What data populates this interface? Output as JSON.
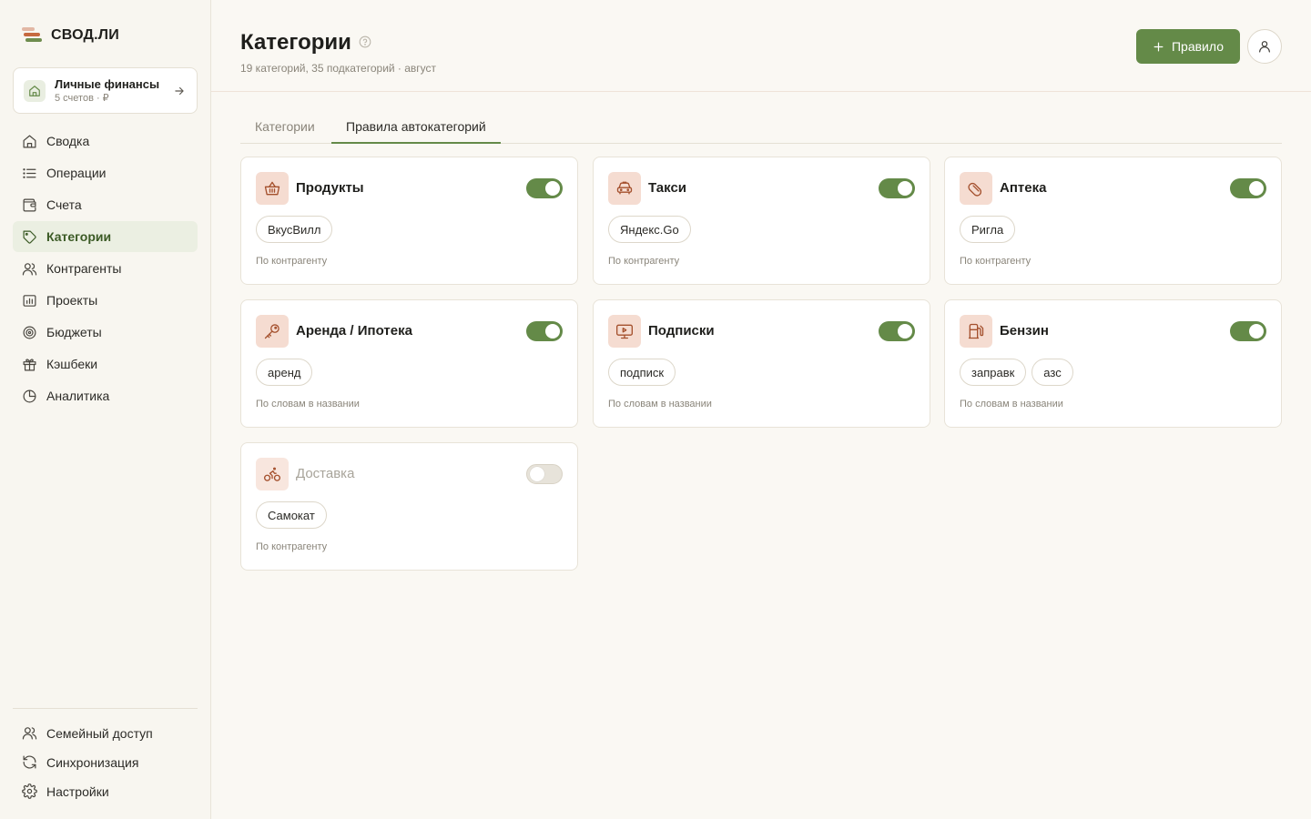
{
  "brand": {
    "name": "СВОД.ЛИ"
  },
  "account": {
    "title": "Личные финансы",
    "subtitle": "5 счетов · ₽"
  },
  "nav": [
    {
      "label": "Сводка",
      "icon": "home-icon"
    },
    {
      "label": "Операции",
      "icon": "list-icon"
    },
    {
      "label": "Счета",
      "icon": "wallet-icon"
    },
    {
      "label": "Категории",
      "icon": "tag-icon",
      "active": true
    },
    {
      "label": "Контрагенты",
      "icon": "users-icon"
    },
    {
      "label": "Проекты",
      "icon": "folder-chart-icon"
    },
    {
      "label": "Бюджеты",
      "icon": "target-icon"
    },
    {
      "label": "Кэшбеки",
      "icon": "gift-icon"
    },
    {
      "label": "Аналитика",
      "icon": "pie-chart-icon"
    }
  ],
  "nav_bottom": [
    {
      "label": "Семейный доступ",
      "icon": "users-icon"
    },
    {
      "label": "Синхронизация",
      "icon": "refresh-icon"
    },
    {
      "label": "Настройки",
      "icon": "gear-icon"
    }
  ],
  "header": {
    "title": "Категории",
    "subtitle": "19 категорий, 35 подкатегорий · август",
    "add_rule_label": "Правило"
  },
  "tabs": [
    {
      "label": "Категории",
      "active": false
    },
    {
      "label": "Правила автокатегорий",
      "active": true
    }
  ],
  "rules": [
    {
      "title": "Продукты",
      "icon": "basket-icon",
      "enabled": true,
      "chips": [
        "ВкусВилл"
      ],
      "rule_type": "По контрагенту"
    },
    {
      "title": "Такси",
      "icon": "car-icon",
      "enabled": true,
      "chips": [
        "Яндекс.Go"
      ],
      "rule_type": "По контрагенту"
    },
    {
      "title": "Аптека",
      "icon": "pill-icon",
      "enabled": true,
      "chips": [
        "Ригла"
      ],
      "rule_type": "По контрагенту"
    },
    {
      "title": "Аренда / Ипотека",
      "icon": "key-icon",
      "enabled": true,
      "chips": [
        "аренд"
      ],
      "rule_type": "По словам в названии"
    },
    {
      "title": "Подписки",
      "icon": "monitor-play-icon",
      "enabled": true,
      "chips": [
        "подписк"
      ],
      "rule_type": "По словам в названии"
    },
    {
      "title": "Бензин",
      "icon": "fuel-icon",
      "enabled": true,
      "chips": [
        "заправк",
        "азс"
      ],
      "rule_type": "По словам в названии"
    },
    {
      "title": "Доставка",
      "icon": "bike-icon",
      "enabled": false,
      "chips": [
        "Самокат"
      ],
      "rule_type": "По контрагенту"
    }
  ],
  "colors": {
    "accent": "#648a48",
    "icon_bg": "#f5dcd1",
    "icon_stroke": "#a4502d"
  }
}
